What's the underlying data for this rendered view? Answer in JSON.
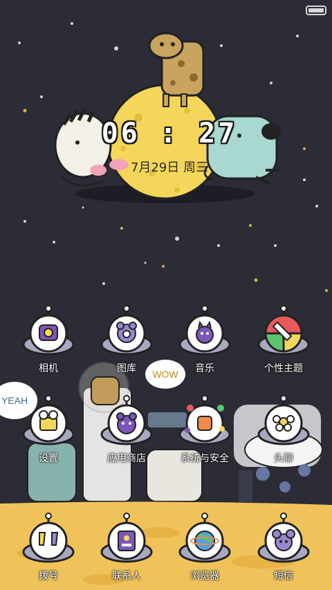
{
  "status_bar": {
    "battery_icon": "battery-icon"
  },
  "lock_clock": {
    "time": "06 : 27",
    "date": "7月29日 周三"
  },
  "bubbles": {
    "wow": "WOW",
    "yeah": "YEAH"
  },
  "apps": {
    "row1": [
      {
        "label": "相机",
        "icon": "camera-icon"
      },
      {
        "label": "图库",
        "icon": "gallery-icon"
      },
      {
        "label": "音乐",
        "icon": "music-icon"
      },
      {
        "label": "个性主题",
        "icon": "theme-icon"
      }
    ],
    "row2": [
      {
        "label": "设置",
        "icon": "settings-icon"
      },
      {
        "label": "应用商店",
        "icon": "app-store-icon"
      },
      {
        "label": "系统与安全",
        "icon": "security-icon"
      },
      {
        "label": "头聊",
        "icon": "chat-icon"
      }
    ],
    "dock": [
      {
        "label": "拨号",
        "icon": "phone-icon"
      },
      {
        "label": "联系人",
        "icon": "contacts-icon"
      },
      {
        "label": "浏览器",
        "icon": "browser-icon"
      },
      {
        "label": "短信",
        "icon": "messages-icon"
      }
    ]
  },
  "colors": {
    "background": "#2b2c35",
    "moon": "#f4d75a",
    "ground": "#f0c35a",
    "label_text": "#ffffff"
  }
}
